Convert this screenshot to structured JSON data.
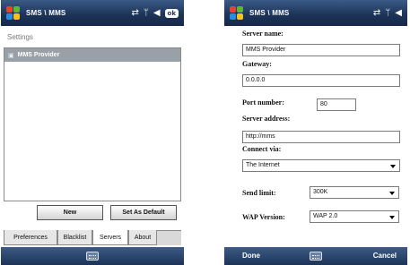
{
  "left_screen": {
    "title": "SMS \\ MMS",
    "status": {
      "signal_icon": "signal-antenna-icon",
      "volume_icon": "speaker-icon",
      "ok_label": "ok"
    },
    "header": "Settings",
    "servers": [
      {
        "name": "MMS Provider"
      }
    ],
    "buttons": {
      "new": "New",
      "set_default": "Set As Default"
    },
    "tabs": [
      "Preferences",
      "Blacklist",
      "Servers",
      "About"
    ],
    "active_tab": "Servers"
  },
  "right_screen": {
    "title": "SMS \\ MMS",
    "form": {
      "server_name_label": "Server name:",
      "server_name_value": "MMS Provider",
      "gateway_label": "Gateway:",
      "gateway_value": "0.0.0.0",
      "port_label": "Port number:",
      "port_value": "80",
      "server_address_label": "Server address:",
      "server_address_value": "http://mms",
      "connect_via_label": "Connect via:",
      "connect_via_value": "The Internet",
      "send_limit_label": "Send limit:",
      "send_limit_value": "300K",
      "wap_version_label": "WAP Version:",
      "wap_version_value": "WAP 2.0"
    },
    "menu": {
      "left": "Done",
      "right": "Cancel"
    }
  },
  "colors": {
    "titlebar": "#1d3558",
    "selection": "#9aa0a8",
    "accent": "#3b5a86"
  }
}
